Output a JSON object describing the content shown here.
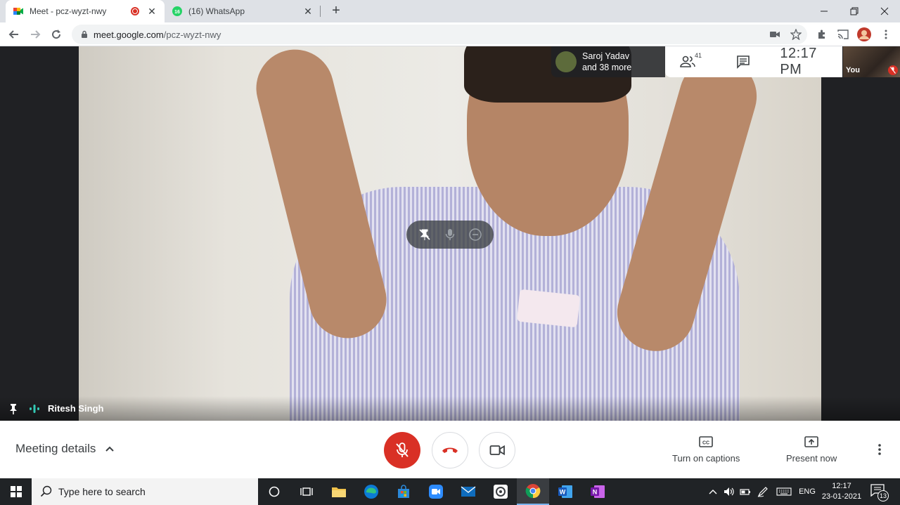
{
  "browser": {
    "tabs": [
      {
        "title": "Meet - pcz-wyzt-nwy",
        "active": true,
        "recording": true
      },
      {
        "title": "(16) WhatsApp",
        "active": false,
        "badge": "16"
      }
    ],
    "url_domain": "meet.google.com",
    "url_path": "/pcz-wyzt-nwy"
  },
  "meet": {
    "speaker_name": "Ritesh Singh",
    "presenter": {
      "line1": "Saroj Yadav",
      "line2": "and 38 more"
    },
    "participants_count": "41",
    "time": "12:17 PM",
    "self_label": "You",
    "meeting_details_label": "Meeting details",
    "captions_label": "Turn on captions",
    "present_label": "Present now",
    "colors": {
      "mic_off": "#d93025",
      "end_call": "#d93025",
      "accent": "#1a73e8"
    }
  },
  "taskbar": {
    "search_placeholder": "Type here to search",
    "language": "ENG",
    "time": "12:17",
    "date": "23-01-2021",
    "notifications": "13",
    "apps": [
      "cortana-icon",
      "task-view-icon",
      "file-explorer-icon",
      "edge-icon",
      "store-icon",
      "zoom-icon",
      "mail-icon",
      "app-icon",
      "chrome-icon",
      "word-icon",
      "onenote-icon"
    ]
  }
}
